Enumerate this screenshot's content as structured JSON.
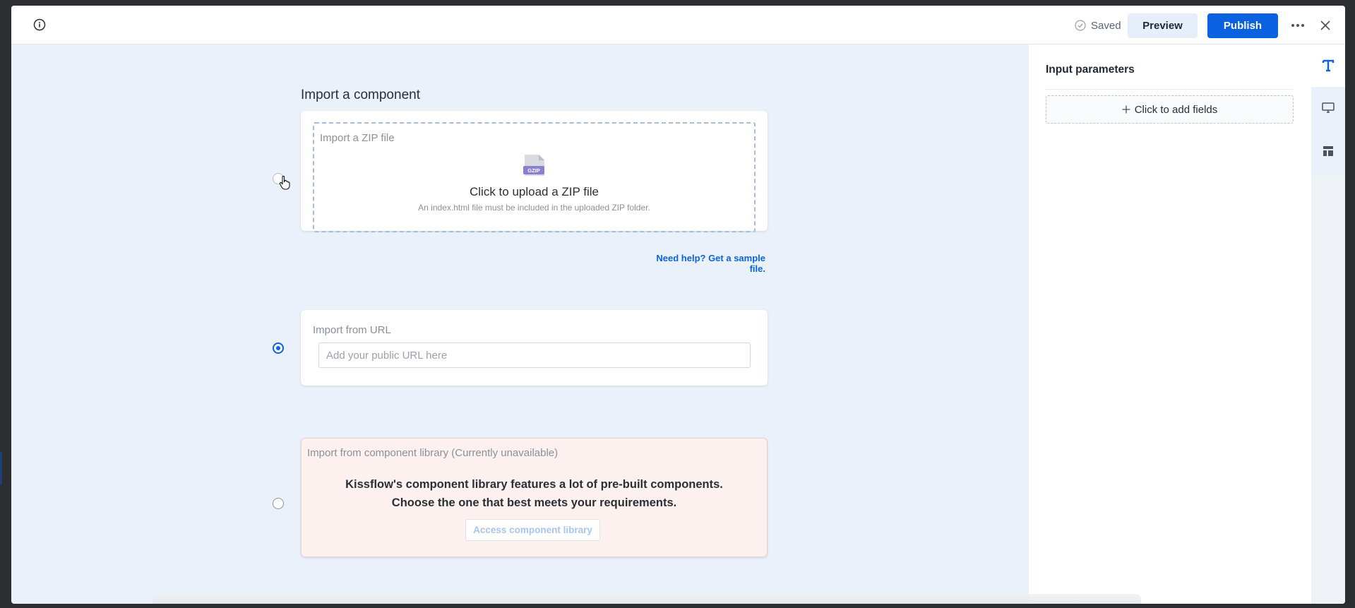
{
  "header": {
    "saved_label": "Saved",
    "preview_label": "Preview",
    "publish_label": "Publish",
    "icons": [
      "info-icon",
      "check-circle-icon",
      "more-icon",
      "close-icon"
    ]
  },
  "main": {
    "heading": "Import a component",
    "zip": {
      "label": "Import a ZIP file",
      "icon_badge": "GZIP",
      "upload_title": "Click to upload a ZIP file",
      "upload_sub": "An index.html file must be included in the uploaded ZIP folder.",
      "help_link": "Need help? Get a sample file."
    },
    "url": {
      "label": "Import from URL",
      "placeholder": "Add your public URL here",
      "value": ""
    },
    "library": {
      "label": "Import from component library (Currently unavailable)",
      "desc_line1": "Kissflow's component library features a lot of pre-built components.",
      "desc_line2": "Choose the one that best meets your requirements.",
      "button_label": "Access component library"
    },
    "selected_option": "url"
  },
  "right_panel": {
    "title": "Input parameters",
    "add_fields_label": "Click to add fields",
    "rail_icons": [
      "text-icon",
      "monitor-icon",
      "layout-icon"
    ]
  },
  "colors": {
    "accent": "#0b62e0",
    "canvas": "#eaf1fb",
    "library_bg": "#fdf1ef"
  }
}
